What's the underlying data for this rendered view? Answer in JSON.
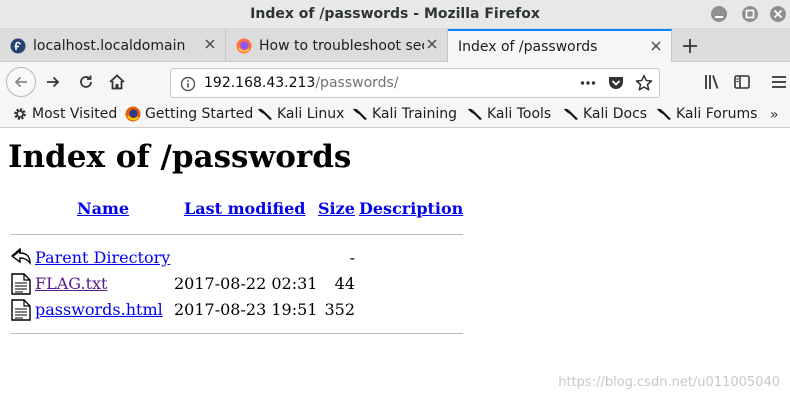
{
  "window": {
    "title": "Index of /passwords - Mozilla Firefox"
  },
  "tabs": [
    {
      "label": "localhost.localdomain",
      "icon": "fedora-icon"
    },
    {
      "label": "How to troubleshoot secu",
      "icon": "firefox-icon"
    },
    {
      "label": "Index of /passwords",
      "icon": "",
      "active": true
    }
  ],
  "urlbar": {
    "host": "192.168.43.213",
    "path": "/passwords/"
  },
  "bookmarks": [
    {
      "label": "Most Visited",
      "icon": "gear-icon"
    },
    {
      "label": "Getting Started",
      "icon": "firefox-icon"
    },
    {
      "label": "Kali Linux",
      "icon": "kali-dragon-icon"
    },
    {
      "label": "Kali Training",
      "icon": "kali-dragon-icon"
    },
    {
      "label": "Kali Tools",
      "icon": "kali-dragon-icon"
    },
    {
      "label": "Kali Docs",
      "icon": "kali-dragon-icon"
    },
    {
      "label": "Kali Forums",
      "icon": "kali-dragon-icon"
    }
  ],
  "bookmarks_overflow": "»",
  "page": {
    "heading": "Index of /passwords",
    "columns": {
      "name": "Name",
      "last_modified": "Last modified",
      "size": "Size",
      "description": "Description"
    },
    "rows": [
      {
        "name": "Parent Directory",
        "date": "",
        "size": "-",
        "icon": "back-arrow-icon"
      },
      {
        "name": "FLAG.txt",
        "date": "2017-08-22 02:31",
        "size": "44",
        "icon": "text-file-icon",
        "visited": true
      },
      {
        "name": "passwords.html",
        "date": "2017-08-23 19:51",
        "size": "352",
        "icon": "text-file-icon"
      }
    ]
  },
  "watermark": "https://blog.csdn.net/u011005040",
  "colors": {
    "link": "#0000ee",
    "visited_link": "#551a8b",
    "tab_accent": "#0a84ff"
  }
}
